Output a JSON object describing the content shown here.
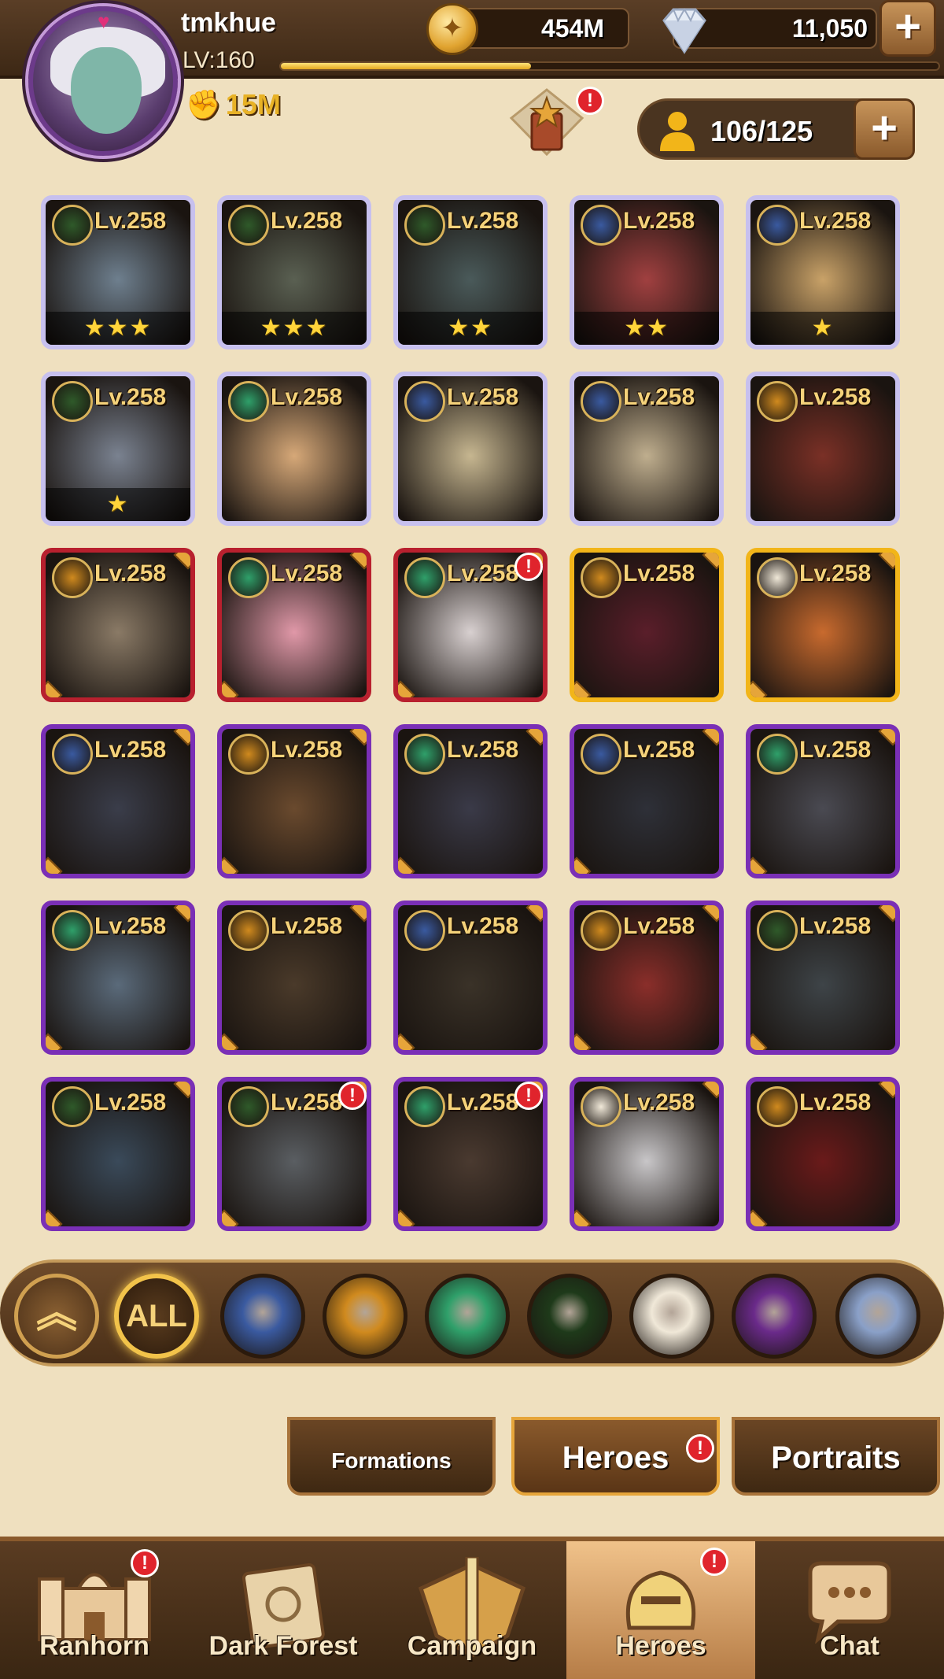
{
  "player": {
    "name": "tmkhue",
    "level": "LV:160",
    "power": "15M",
    "xp_fraction": 0.38
  },
  "currency": {
    "gold": "454M",
    "diamonds": "11,050"
  },
  "roster": {
    "count": "106/125"
  },
  "heroes": [
    {
      "level": "Lv.258",
      "frame": "ascended",
      "faction": "graveborn",
      "stars": "★★★",
      "alert": false,
      "portrait": "#6e7f8e"
    },
    {
      "level": "Lv.258",
      "frame": "ascended",
      "faction": "graveborn",
      "stars": "★★★",
      "alert": false,
      "portrait": "#5a6052"
    },
    {
      "level": "Lv.258",
      "frame": "ascended",
      "faction": "graveborn",
      "stars": "★★",
      "alert": false,
      "portrait": "#4a5a5a"
    },
    {
      "level": "Lv.258",
      "frame": "ascended",
      "faction": "lightbearer",
      "stars": "★★",
      "alert": false,
      "portrait": "#a04040"
    },
    {
      "level": "Lv.258",
      "frame": "ascended",
      "faction": "lightbearer",
      "stars": "★",
      "alert": false,
      "portrait": "#c9a268"
    },
    {
      "level": "Lv.258",
      "frame": "ascended",
      "faction": "graveborn",
      "stars": "★",
      "alert": false,
      "portrait": "#7a8290"
    },
    {
      "level": "Lv.258",
      "frame": "ascended",
      "faction": "wilder",
      "stars": "",
      "alert": false,
      "portrait": "#d6a878"
    },
    {
      "level": "Lv.258",
      "frame": "ascended",
      "faction": "lightbearer",
      "stars": "",
      "alert": false,
      "portrait": "#c6b690"
    },
    {
      "level": "Lv.258",
      "frame": "ascended",
      "faction": "lightbearer",
      "stars": "",
      "alert": false,
      "portrait": "#bfae8e"
    },
    {
      "level": "Lv.258",
      "frame": "ascended",
      "faction": "mauler",
      "stars": "",
      "alert": false,
      "portrait": "#7a3026"
    },
    {
      "level": "Lv.258",
      "frame": "mythic",
      "faction": "mauler",
      "stars": "",
      "alert": false,
      "portrait": "#8a7a66"
    },
    {
      "level": "Lv.258",
      "frame": "mythic",
      "faction": "wilder",
      "stars": "",
      "alert": false,
      "portrait": "#e098a8"
    },
    {
      "level": "Lv.258",
      "frame": "mythic",
      "faction": "wilder",
      "stars": "",
      "alert": true,
      "portrait": "#d8d0d0"
    },
    {
      "level": "Lv.258",
      "frame": "gold",
      "faction": "mauler",
      "stars": "",
      "alert": false,
      "portrait": "#5a1e2a"
    },
    {
      "level": "Lv.258",
      "frame": "gold",
      "faction": "celestial",
      "stars": "",
      "alert": false,
      "portrait": "#c86a2e"
    },
    {
      "level": "Lv.258",
      "frame": "legend",
      "faction": "lightbearer",
      "stars": "",
      "alert": false,
      "portrait": "#3a3d4a"
    },
    {
      "level": "Lv.258",
      "frame": "legend",
      "faction": "mauler",
      "stars": "",
      "alert": false,
      "portrait": "#6a4a2e"
    },
    {
      "level": "Lv.258",
      "frame": "legend",
      "faction": "wilder",
      "stars": "",
      "alert": false,
      "portrait": "#3a3a48"
    },
    {
      "level": "Lv.258",
      "frame": "legend",
      "faction": "lightbearer",
      "stars": "",
      "alert": false,
      "portrait": "#2e3038"
    },
    {
      "level": "Lv.258",
      "frame": "legend",
      "faction": "wilder",
      "stars": "",
      "alert": false,
      "portrait": "#4a4a52"
    },
    {
      "level": "Lv.258",
      "frame": "legend",
      "faction": "wilder",
      "stars": "",
      "alert": false,
      "portrait": "#5a6a7a"
    },
    {
      "level": "Lv.258",
      "frame": "legend",
      "faction": "mauler",
      "stars": "",
      "alert": false,
      "portrait": "#4a3a2a"
    },
    {
      "level": "Lv.258",
      "frame": "legend",
      "faction": "lightbearer",
      "stars": "",
      "alert": false,
      "portrait": "#3a3228"
    },
    {
      "level": "Lv.258",
      "frame": "legend",
      "faction": "mauler",
      "stars": "",
      "alert": false,
      "portrait": "#8a2e2a"
    },
    {
      "level": "Lv.258",
      "frame": "legend",
      "faction": "graveborn",
      "stars": "",
      "alert": false,
      "portrait": "#3e4448"
    },
    {
      "level": "Lv.258",
      "frame": "legend",
      "faction": "graveborn",
      "stars": "",
      "alert": false,
      "portrait": "#3a4a5a"
    },
    {
      "level": "Lv.258",
      "frame": "legend",
      "faction": "graveborn",
      "stars": "",
      "alert": true,
      "portrait": "#5a5e62"
    },
    {
      "level": "Lv.258",
      "frame": "legend",
      "faction": "wilder",
      "stars": "",
      "alert": true,
      "portrait": "#4a3a30"
    },
    {
      "level": "Lv.258",
      "frame": "legend",
      "faction": "celestial",
      "stars": "",
      "alert": false,
      "portrait": "#c8c6c8"
    },
    {
      "level": "Lv.258",
      "frame": "legend",
      "faction": "mauler",
      "stars": "",
      "alert": false,
      "portrait": "#6a1a1a"
    }
  ],
  "faction_colors": {
    "graveborn": "#2f5a2a",
    "lightbearer": "#3a5aa0",
    "mauler": "#d08a1e",
    "wilder": "#2fa06a",
    "celestial": "#f0e8d8"
  },
  "filters": [
    {
      "id": "collapse",
      "icon": "chevron-up-icon"
    },
    {
      "id": "all",
      "label": "ALL"
    },
    {
      "id": "lightbearer",
      "icon": "lightbearer-icon",
      "color": "#3a5aa0"
    },
    {
      "id": "mauler",
      "icon": "mauler-icon",
      "color": "#d08a1e"
    },
    {
      "id": "wilder",
      "icon": "wilder-icon",
      "color": "#2fa06a"
    },
    {
      "id": "graveborn",
      "icon": "graveborn-icon",
      "color": "#1e3a1a"
    },
    {
      "id": "celestial",
      "icon": "celestial-icon",
      "color": "#f0e8d8"
    },
    {
      "id": "hypogean",
      "icon": "hypogean-icon",
      "color": "#6a2a8a"
    },
    {
      "id": "dimensional",
      "icon": "dimensional-icon",
      "color": "#8aa0c8"
    }
  ],
  "subtabs": {
    "formations": "Formations",
    "heroes": "Heroes",
    "portraits": "Portraits"
  },
  "nav": {
    "ranhorn": "Ranhorn",
    "dark_forest": "Dark Forest",
    "campaign": "Campaign",
    "heroes": "Heroes",
    "chat": "Chat"
  }
}
